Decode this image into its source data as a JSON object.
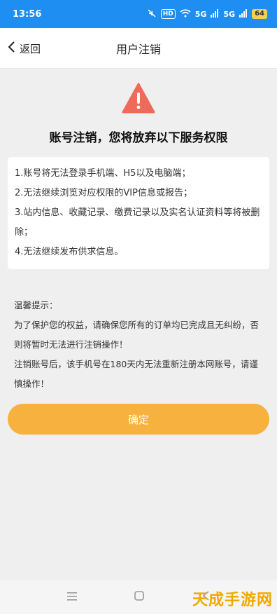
{
  "status_bar": {
    "time": "13:56",
    "hd_label": "HD",
    "network_1": "5G",
    "network_2": "5G",
    "battery": "64"
  },
  "nav": {
    "back_label": "返回",
    "title": "用户注销"
  },
  "headline": "账号注销，您将放弃以下服务权限",
  "consequences": [
    "1.账号将无法登录手机端、H5以及电脑端；",
    "2.无法继续浏览对应权限的VIP信息或报告；",
    "3.站内信息、收藏记录、缴费记录以及实名认证资料等将被删除；",
    "4.无法继续发布供求信息。"
  ],
  "tips": {
    "title": "温馨提示：",
    "line1": "为了保护您的权益，请确保您所有的订单均已完成且无纠纷，否则将暂时无法进行注销操作！",
    "line2": "注销账号后，该手机号在180天内无法重新注册本网账号，请谨慎操作！"
  },
  "confirm_label": "确定",
  "watermark": "天成手游网",
  "colors": {
    "status_bar": "#1e8ef2",
    "warning": "#ee6b5b",
    "confirm": "#f7b13e"
  }
}
